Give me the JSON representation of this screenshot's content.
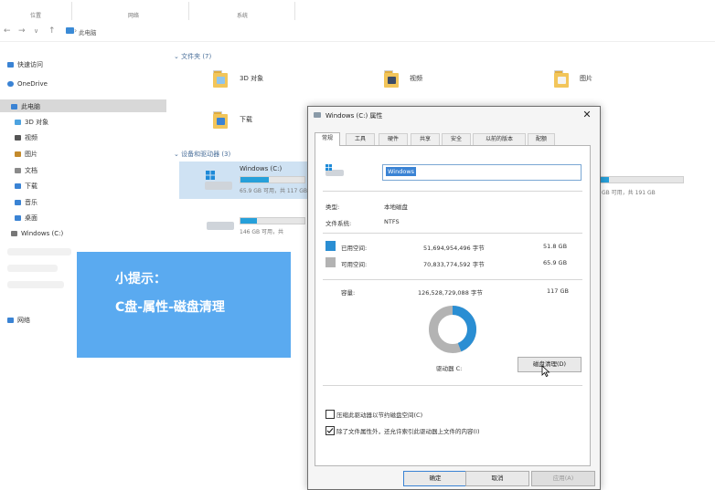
{
  "ribbon": {
    "groups": [
      {
        "label": "位置"
      },
      {
        "label": "网络"
      },
      {
        "label": "系统"
      }
    ]
  },
  "address": {
    "back": "←",
    "forward": "→",
    "dropdown": "∨",
    "up": "↑",
    "path_sep": "›",
    "path": "此电脑"
  },
  "sidebar": {
    "items": [
      {
        "label": "快速访问",
        "icon": "star-icon",
        "color": "#3a83d4"
      },
      {
        "label": "OneDrive",
        "icon": "cloud-icon",
        "color": "#3a83d4"
      },
      {
        "label": "此电脑",
        "icon": "computer-icon",
        "color": "#3a83d4"
      },
      {
        "label": "3D 对象",
        "icon": "cube-icon",
        "color": "#4da3e0"
      },
      {
        "label": "视频",
        "icon": "video-icon",
        "color": "#555555"
      },
      {
        "label": "图片",
        "icon": "picture-icon",
        "color": "#c38a2c"
      },
      {
        "label": "文档",
        "icon": "document-icon",
        "color": "#8a8a8a"
      },
      {
        "label": "下载",
        "icon": "download-icon",
        "color": "#3a83d4"
      },
      {
        "label": "音乐",
        "icon": "music-icon",
        "color": "#3a83d4"
      },
      {
        "label": "桌面",
        "icon": "desktop-icon",
        "color": "#3a83d4"
      },
      {
        "label": "Windows (C:)",
        "icon": "drive-icon",
        "color": "#777777"
      },
      {
        "label": "网络",
        "icon": "network-icon",
        "color": "#3a83d4"
      }
    ]
  },
  "content": {
    "folders_header": "文件夹 (7)",
    "folders": [
      {
        "name": "3D 对象",
        "icon": "cube-folder-icon",
        "badge": "#8fc5ee"
      },
      {
        "name": "视频",
        "icon": "video-folder-icon",
        "badge": "#3c4b66"
      },
      {
        "name": "图片",
        "icon": "picture-folder-icon",
        "badge": "#f3f3f3"
      },
      {
        "name": "下载",
        "icon": "download-folder-icon",
        "badge": "#3a83d4"
      }
    ],
    "devices_header": "设备和驱动器 (3)",
    "drives": [
      {
        "name": "Windows (C:)",
        "free_text": "65.9 GB 可用，共 117 GB",
        "usage": 0.44
      },
      {
        "name": "",
        "free_text": "146 GB 可用，共",
        "usage": 0.25
      },
      {
        "name": "",
        "free_text": "GB 可用，共 191 GB",
        "usage": 0.1
      }
    ]
  },
  "tip": {
    "title": "小提示：",
    "body": "C盘-属性-磁盘清理"
  },
  "dialog": {
    "title": "Windows (C:) 属性",
    "close": "✕",
    "tabs": [
      "常规",
      "工具",
      "硬件",
      "共享",
      "安全",
      "以前的版本",
      "配额"
    ],
    "name_value": "Windows",
    "type_label": "类型:",
    "type_value": "本地磁盘",
    "fs_label": "文件系统:",
    "fs_value": "NTFS",
    "used_label": "已用空间:",
    "used_bytes": "51,694,954,496 字节",
    "used_gb": "51.8 GB",
    "free_label": "可用空间:",
    "free_bytes": "70,833,774,592 字节",
    "free_gb": "65.9 GB",
    "capacity_label": "容量:",
    "capacity_bytes": "126,528,729,088 字节",
    "capacity_gb": "117 GB",
    "drive_label": "驱动器 C:",
    "cleanup_button": "磁盘清理(D)",
    "compress_label": "压缩此驱动器以节约磁盘空间(C)",
    "compress_checked": false,
    "index_label": "除了文件属性外，还允许索引此驱动器上文件的内容(I)",
    "index_checked": true,
    "ok_button": "确定",
    "cancel_button": "取消",
    "apply_button": "应用(A)",
    "used_fraction": 0.44,
    "used_color": "#2a8ed3",
    "free_color": "#b3b3b3"
  }
}
